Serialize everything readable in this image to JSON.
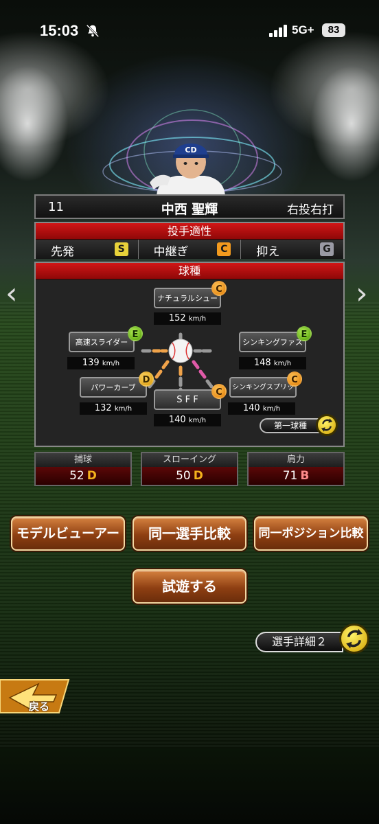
{
  "status_bar": {
    "time": "15:03",
    "network": "5G+",
    "battery": "83"
  },
  "player": {
    "number": "11",
    "name": "中西 聖輝",
    "handedness": "右投右打"
  },
  "aptitude": {
    "title": "投手適性",
    "roles": [
      {
        "label": "先発",
        "grade": "S",
        "color": "#e8d23a"
      },
      {
        "label": "中継ぎ",
        "grade": "C",
        "color": "#f39a1e"
      },
      {
        "label": "抑え",
        "grade": "G",
        "color": "#9a9aa5"
      }
    ]
  },
  "pitches": {
    "title": "球種",
    "items": [
      {
        "name": "ナチュラルシュート",
        "grade": "C",
        "speed": "152",
        "unit": "km/h"
      },
      {
        "name": "高速スライダー",
        "grade": "E",
        "speed": "139",
        "unit": "km/h"
      },
      {
        "name": "シンキングファスト",
        "grade": "E",
        "speed": "148",
        "unit": "km/h"
      },
      {
        "name": "パワーカーブ",
        "grade": "D",
        "speed": "132",
        "unit": "km/h"
      },
      {
        "name": "S F F",
        "grade": "C",
        "speed": "140",
        "unit": "km/h"
      },
      {
        "name": "シンキングスプリット",
        "grade": "C",
        "speed": "140",
        "unit": "km/h"
      }
    ],
    "first_pitch_label": "第一球種"
  },
  "stats": [
    {
      "label": "捕球",
      "value": "52",
      "grade": "D",
      "grade_color": "#f5b21c"
    },
    {
      "label": "スローイング",
      "value": "50",
      "grade": "D",
      "grade_color": "#f5b21c"
    },
    {
      "label": "肩力",
      "value": "71",
      "grade": "B",
      "grade_color": "#ff8a8a"
    }
  ],
  "buttons": {
    "model_viewer": "モデルビューアー",
    "compare_same_player": "同一選手比較",
    "compare_same_position": "同一ポジション比較",
    "trial_play": "試遊する",
    "player_detail_2": "選手詳細２",
    "back": "戻る"
  },
  "nav": {
    "prev": "‹",
    "next": "›"
  }
}
